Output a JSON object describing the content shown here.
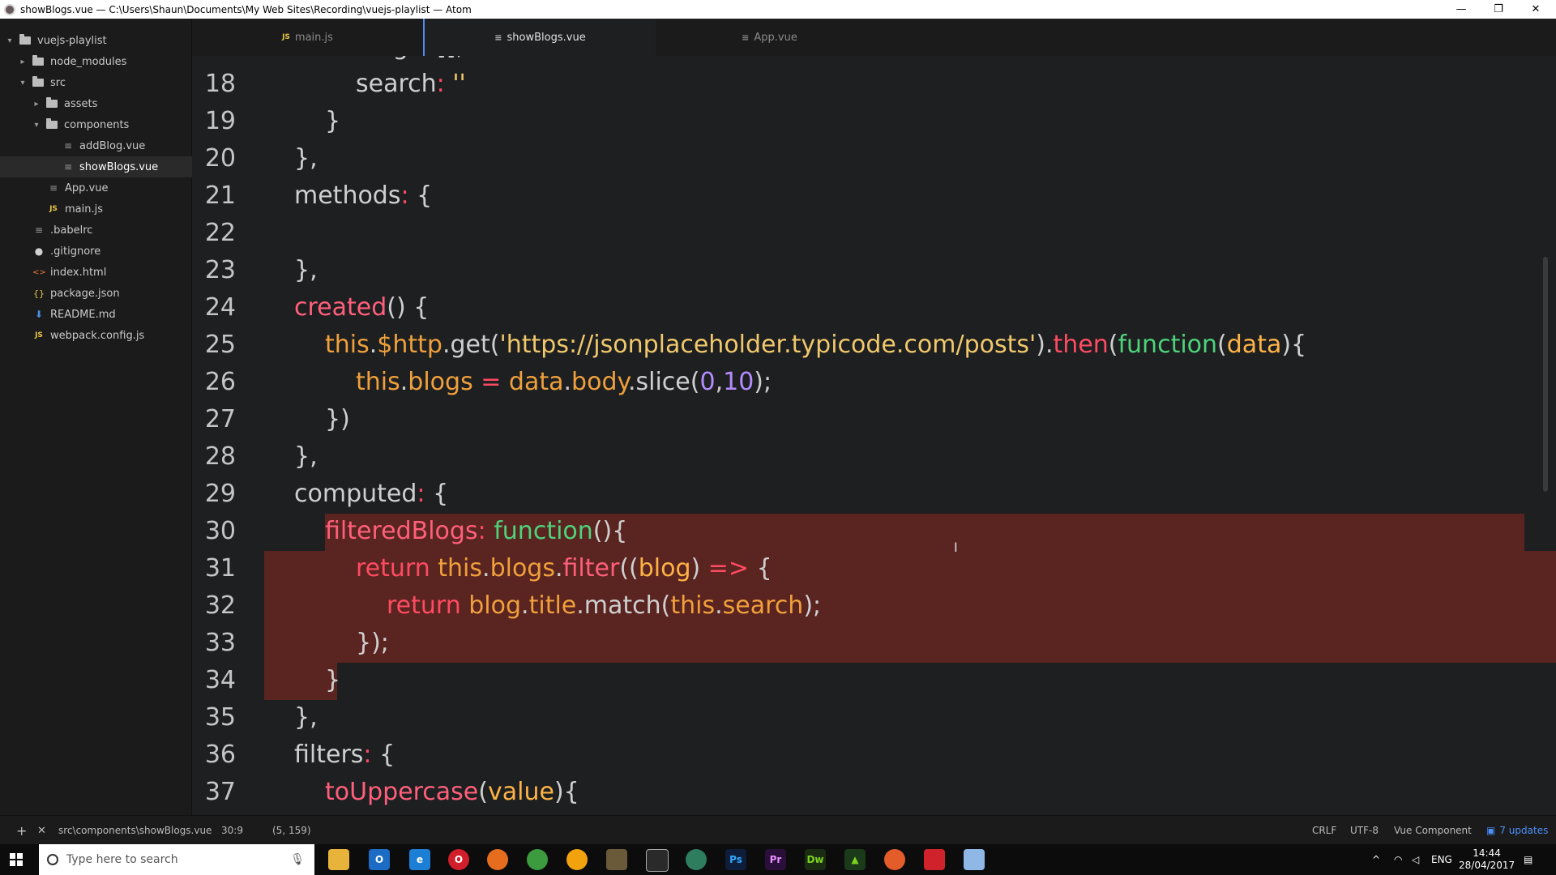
{
  "window": {
    "title": "showBlogs.vue — C:\\Users\\Shaun\\Documents\\My Web Sites\\Recording\\vuejs-playlist — Atom",
    "minimize": "—",
    "restore": "❐",
    "close": "✕"
  },
  "sidebar": {
    "items": [
      {
        "label": "vuejs-playlist",
        "arrow": "▾",
        "icon": "folder-icon"
      },
      {
        "label": "node_modules",
        "arrow": "▸",
        "icon": "folder-icon"
      },
      {
        "label": "src",
        "arrow": "▾",
        "icon": "folder-icon"
      },
      {
        "label": "assets",
        "arrow": "▸",
        "icon": "folder-icon"
      },
      {
        "label": "components",
        "arrow": "▾",
        "icon": "folder-icon"
      },
      {
        "label": "addBlog.vue",
        "icon": "file-text-icon",
        "glyph": "≡"
      },
      {
        "label": "showBlogs.vue",
        "icon": "file-text-icon",
        "glyph": "≡"
      },
      {
        "label": "App.vue",
        "icon": "file-text-icon",
        "glyph": "≡"
      },
      {
        "label": "main.js",
        "icon": "js-file-icon",
        "glyph": "JS"
      },
      {
        "label": ".babelrc",
        "icon": "file-text-icon",
        "glyph": "≡"
      },
      {
        "label": ".gitignore",
        "icon": "github-icon",
        "glyph": "●"
      },
      {
        "label": "index.html",
        "icon": "html-file-icon",
        "glyph": "<>"
      },
      {
        "label": "package.json",
        "icon": "json-file-icon",
        "glyph": "{}"
      },
      {
        "label": "README.md",
        "icon": "markdown-file-icon",
        "glyph": "⬇"
      },
      {
        "label": "webpack.config.js",
        "icon": "js-file-icon",
        "glyph": "JS"
      }
    ]
  },
  "tabs": [
    {
      "label": "main.js",
      "glyph": "JS"
    },
    {
      "label": "showBlogs.vue",
      "glyph": "≡"
    },
    {
      "label": "App.vue",
      "glyph": "≡"
    }
  ],
  "editor": {
    "line_numbers": [
      "18",
      "19",
      "20",
      "21",
      "22",
      "23",
      "24",
      "25",
      "26",
      "27",
      "28",
      "29",
      "30",
      "31",
      "32",
      "33",
      "34",
      "35",
      "36",
      "37"
    ],
    "top_partial": "blogs: [],"
  },
  "statusbar": {
    "add": "+",
    "close": "✕",
    "path": "src\\components\\showBlogs.vue",
    "cursor": "30:9",
    "selection": "(5, 159)",
    "line_ending": "CRLF",
    "encoding": "UTF-8",
    "grammar": "Vue Component",
    "updates": "7 updates"
  },
  "taskbar": {
    "search_placeholder": "Type here to search",
    "language": "ENG",
    "time": "14:44",
    "date": "28/04/2017"
  },
  "colors": {
    "keyword": "#ff4b62",
    "function": "#4ed37b",
    "string": "#f1c86b",
    "number": "#b48cff",
    "selection": "#5a2420",
    "accent": "#568af2"
  }
}
